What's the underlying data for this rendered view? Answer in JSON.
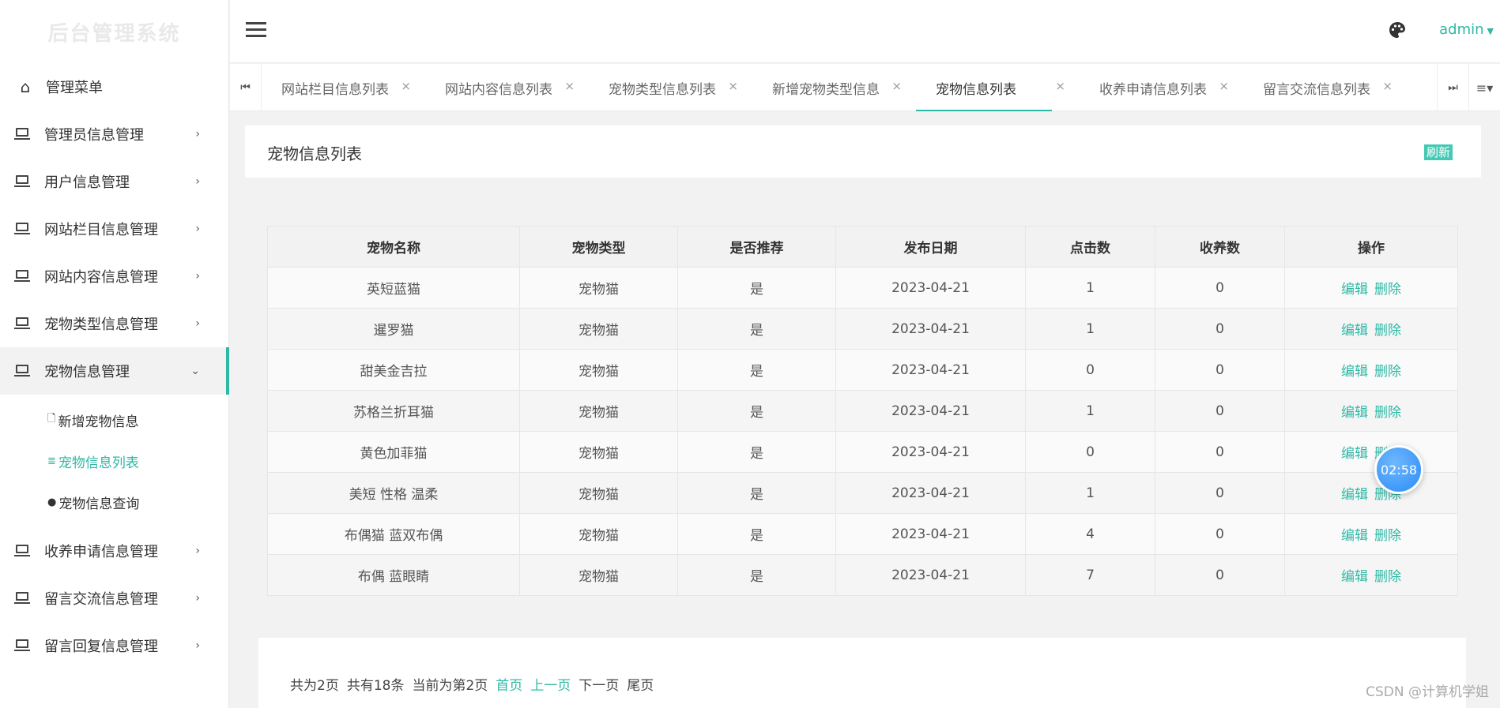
{
  "app": {
    "title": "后台管理系统"
  },
  "sidebar": {
    "header": "管理菜单",
    "items": [
      {
        "label": "管理员信息管理"
      },
      {
        "label": "用户信息管理"
      },
      {
        "label": "网站栏目信息管理"
      },
      {
        "label": "网站内容信息管理"
      },
      {
        "label": "宠物类型信息管理"
      },
      {
        "label": "宠物信息管理"
      },
      {
        "label": "收养申请信息管理"
      },
      {
        "label": "留言交流信息管理"
      },
      {
        "label": "留言回复信息管理"
      }
    ],
    "submenu": [
      {
        "label": "新增宠物信息"
      },
      {
        "label": "宠物信息列表"
      },
      {
        "label": "宠物信息查询"
      }
    ]
  },
  "header": {
    "user": "admin"
  },
  "tabs": [
    {
      "label": "网站栏目信息列表"
    },
    {
      "label": "网站内容信息列表"
    },
    {
      "label": "宠物类型信息列表"
    },
    {
      "label": "新增宠物类型信息"
    },
    {
      "label": "宠物信息列表"
    },
    {
      "label": "收养申请信息列表"
    },
    {
      "label": "留言交流信息列表"
    }
  ],
  "page": {
    "title": "宠物信息列表",
    "refresh": "刷新"
  },
  "table": {
    "headers": [
      "宠物名称",
      "宠物类型",
      "是否推荐",
      "发布日期",
      "点击数",
      "收养数",
      "操作"
    ],
    "edit_label": "编辑",
    "delete_label": "删除",
    "rows": [
      [
        "英短蓝猫",
        "宠物猫",
        "是",
        "2023-04-21",
        "1",
        "0"
      ],
      [
        "暹罗猫",
        "宠物猫",
        "是",
        "2023-04-21",
        "1",
        "0"
      ],
      [
        "甜美金吉拉",
        "宠物猫",
        "是",
        "2023-04-21",
        "0",
        "0"
      ],
      [
        "苏格兰折耳猫",
        "宠物猫",
        "是",
        "2023-04-21",
        "1",
        "0"
      ],
      [
        "黄色加菲猫",
        "宠物猫",
        "是",
        "2023-04-21",
        "0",
        "0"
      ],
      [
        "美短 性格 温柔",
        "宠物猫",
        "是",
        "2023-04-21",
        "1",
        "0"
      ],
      [
        "布偶猫 蓝双布偶",
        "宠物猫",
        "是",
        "2023-04-21",
        "4",
        "0"
      ],
      [
        "布偶 蓝眼睛",
        "宠物猫",
        "是",
        "2023-04-21",
        "7",
        "0"
      ]
    ]
  },
  "pager": {
    "total_pages": "共为2页",
    "total_items": "共有18条",
    "current": "当前为第2页",
    "first": "首页",
    "prev": "上一页",
    "next": "下一页",
    "last": "尾页"
  },
  "timer": "02:58",
  "watermark": "CSDN @计算机学姐",
  "colors": {
    "accent": "#2eb8a6"
  }
}
